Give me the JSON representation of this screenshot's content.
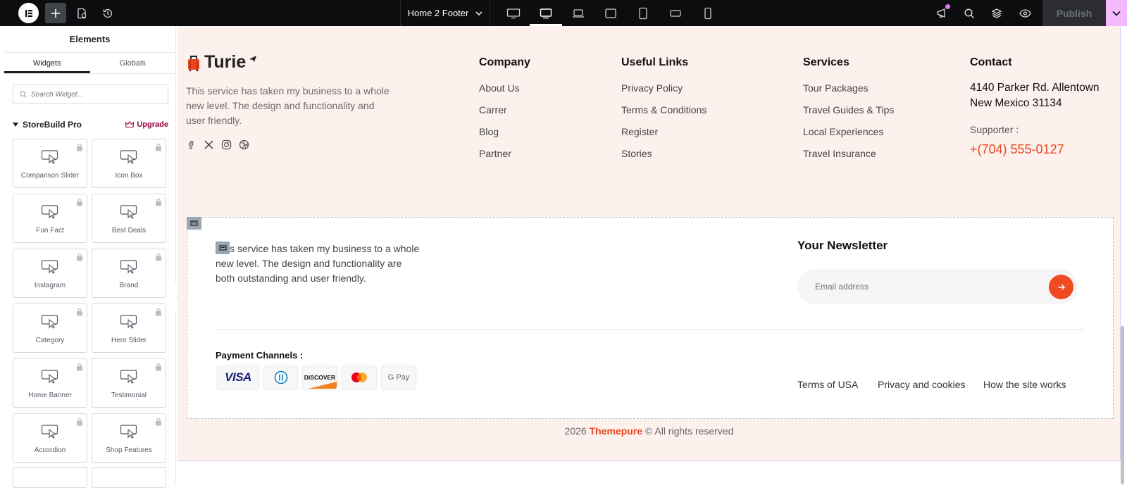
{
  "topbar": {
    "doc_title": "Home 2 Footer",
    "publish_label": "Publish",
    "devices": [
      "desktop-icon",
      "tablet-landscape-icon",
      "laptop-icon",
      "tablet-icon",
      "tablet-portrait-icon",
      "mobile-landscape-icon",
      "mobile-icon"
    ],
    "right_icons": [
      "notification-icon",
      "search-icon",
      "layers-icon",
      "preview-icon"
    ]
  },
  "sidebar": {
    "title": "Elements",
    "tabs": [
      "Widgets",
      "Globals"
    ],
    "search_placeholder": "Search Widget...",
    "category": "StoreBuild Pro",
    "upgrade_label": "Upgrade",
    "widgets": [
      "Comparison Slider",
      "Icon Box",
      "Fun Fact",
      "Best Deals",
      "Instagram",
      "Brand",
      "Category",
      "Hero Slider",
      "Home Banner",
      "Testimonial",
      "Accordion",
      "Shop Features"
    ]
  },
  "footer": {
    "brand": "Turie",
    "about": "This service has taken my business to a whole new level. The design and functionality and user friendly.",
    "socials": [
      "facebook-icon",
      "x-icon",
      "instagram-icon",
      "dribbble-icon"
    ],
    "columns": [
      {
        "title": "Company",
        "links": [
          "About Us",
          "Carrer",
          "Blog",
          "Partner"
        ]
      },
      {
        "title": "Useful Links",
        "links": [
          "Privacy Policy",
          "Terms & Conditions",
          "Register",
          "Stories"
        ]
      },
      {
        "title": "Services",
        "links": [
          "Tour Packages",
          "Travel Guides & Tips",
          "Local Experiences",
          "Travel Insurance"
        ]
      }
    ],
    "contact": {
      "title": "Contact",
      "address_line1": "4140 Parker Rd. Allentown",
      "address_line2": "New Mexico 31134",
      "supporter_label": "Supporter :",
      "phone": "+(704) 555-0127"
    },
    "section2": {
      "text": "s service has taken my business to a whole new level. The design and functionality are both outstanding and user friendly.",
      "newsletter_title": "Your Newsletter",
      "email_placeholder": "Email address",
      "payment_title": "Payment Channels :",
      "payments": [
        "VISA",
        "Diners Club",
        "DISCOVER",
        "Mastercard",
        "G Pay"
      ],
      "bottom_links": [
        "Terms of USA",
        "Privacy and cookies",
        "How the site works"
      ]
    },
    "copyright": {
      "year": "2026",
      "brand": "Themepure",
      "rest": "© All rights reserved"
    }
  },
  "colors": {
    "accent": "#ef4a22",
    "footer_bg": "#fdf1ee",
    "topbar_bg": "#0c0d0e",
    "upgrade": "#93003f"
  }
}
